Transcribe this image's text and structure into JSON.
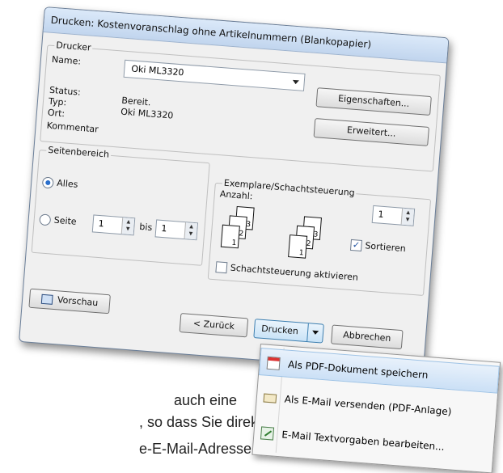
{
  "background_text": [
    "auch eine",
    ", so dass Sie direkt",
    "e-E-Mail-Adresse des"
  ],
  "dialog": {
    "title": "Drucken: Kostenvoranschlag ohne Artikelnummern (Blankopapier)",
    "printer_group": "Drucker",
    "name_label": "Name:",
    "printer_selected": "Oki ML3320",
    "status_label": "Status:",
    "status_value": "Bereit.",
    "type_label": "Typ:",
    "type_value": "Oki ML3320",
    "location_label": "Ort:",
    "comment_label": "Kommentar",
    "properties_button": "Eigenschaften...",
    "advanced_button": "Erweitert...",
    "page_range_group": "Seitenbereich",
    "all_label": "Alles",
    "page_label": "Seite",
    "page_from": "1",
    "to_label": "bis",
    "page_to": "1",
    "copies_group": "Exemplare/Schachtsteuerung",
    "count_label": "Anzahl:",
    "count_value": "1",
    "collate_label": "Sortieren",
    "tray_label": "Schachtsteuerung aktivieren",
    "preview_button": "Vorschau",
    "back_button": "< Zurück",
    "print_button": "Drucken",
    "cancel_button": "Abbrechen"
  },
  "menu": {
    "items": [
      {
        "label": "Als PDF-Dokument speichern",
        "icon": "pdf-document-icon"
      },
      {
        "label": "Als E-Mail versenden (PDF-Anlage)",
        "icon": "email-icon"
      },
      {
        "label": "E-Mail Textvorgaben bearbeiten...",
        "icon": "edit-icon"
      }
    ]
  },
  "colors": {
    "accent": "#2a6fcc",
    "dialog_bg": "#f0f0f0",
    "title_bar": "#c1d5ee",
    "highlight": "#cbe0f6"
  }
}
